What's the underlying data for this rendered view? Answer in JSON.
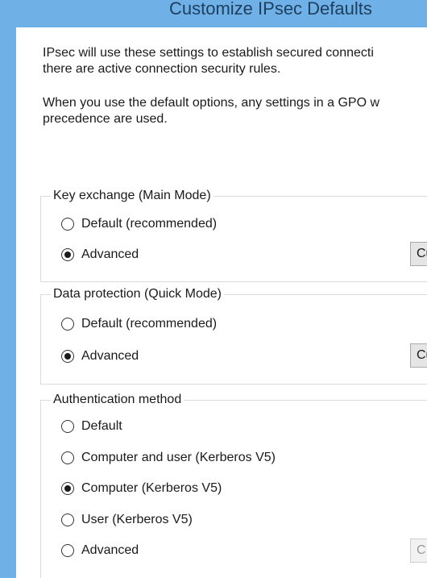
{
  "dialog": {
    "title": "Customize IPsec Defaults",
    "intro_line1": "IPsec will use these settings to establish secured connecti",
    "intro_line2": "there are active connection security rules.",
    "default_note_line1": "When you use the default options, any settings in a GPO w",
    "default_note_line2": "precedence are used."
  },
  "key_exchange": {
    "legend": "Key exchange (Main Mode)",
    "options": [
      {
        "label": "Default (recommended)",
        "checked": false
      },
      {
        "label": "Advanced",
        "checked": true
      }
    ],
    "customize_button": "Cu"
  },
  "data_protection": {
    "legend": "Data protection (Quick Mode)",
    "options": [
      {
        "label": "Default (recommended)",
        "checked": false
      },
      {
        "label": "Advanced",
        "checked": true
      }
    ],
    "customize_button": "Cu"
  },
  "authentication": {
    "legend": "Authentication method",
    "options": [
      {
        "label": "Default",
        "checked": false
      },
      {
        "label": "Computer and user (Kerberos V5)",
        "checked": false
      },
      {
        "label": "Computer (Kerberos V5)",
        "checked": true
      },
      {
        "label": "User (Kerberos V5)",
        "checked": false
      },
      {
        "label": "Advanced",
        "checked": false
      }
    ],
    "customize_button": "C",
    "customize_button_enabled": false
  },
  "colors": {
    "title_bar": "#6fb1e6",
    "title_text": "#1e3f60",
    "group_border": "#dcdcdc",
    "button_face": "#e5e5e5"
  }
}
